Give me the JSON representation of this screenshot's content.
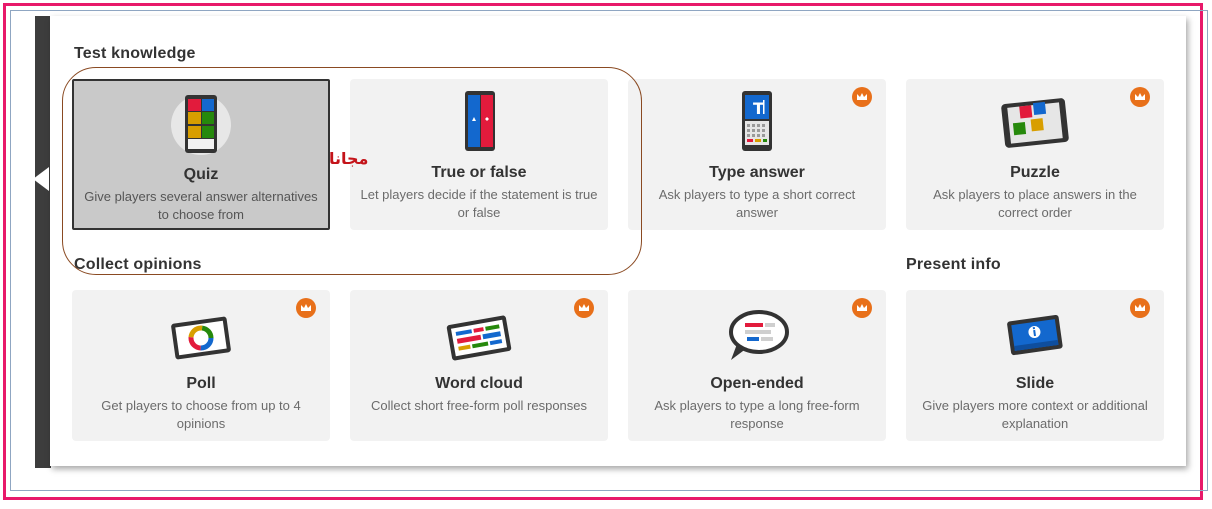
{
  "sections": {
    "test_knowledge": "Test knowledge",
    "collect_opinions": "Collect opinions",
    "present_info": "Present info"
  },
  "annotation": {
    "free_label": "مجانا"
  },
  "colors": {
    "frame_border": "#e8196a",
    "selected_card": "#c9c9c9",
    "card_bg": "#f2f2f2",
    "crown": "#e8701a",
    "annotation_text": "#c4141a",
    "annotation_oval": "#8a4a22"
  },
  "cards": {
    "quiz": {
      "title": "Quiz",
      "desc": "Give players several answer alternatives to choose from",
      "icon": "quiz-icon",
      "premium": false,
      "selected": true
    },
    "true_false": {
      "title": "True or false",
      "desc": "Let players decide if the statement is true or false",
      "icon": "true-false-icon",
      "premium": false
    },
    "type_answer": {
      "title": "Type answer",
      "desc": "Ask players to type a short correct answer",
      "icon": "type-answer-icon",
      "premium": true
    },
    "puzzle": {
      "title": "Puzzle",
      "desc": "Ask players to place answers in the correct order",
      "icon": "puzzle-icon",
      "premium": true
    },
    "poll": {
      "title": "Poll",
      "desc": "Get players to choose from up to 4 opinions",
      "icon": "poll-icon",
      "premium": true
    },
    "word_cloud": {
      "title": "Word cloud",
      "desc": "Collect short free-form poll responses",
      "icon": "word-cloud-icon",
      "premium": true
    },
    "open_ended": {
      "title": "Open-ended",
      "desc": "Ask players to type a long free-form response",
      "icon": "open-ended-icon",
      "premium": true
    },
    "slide": {
      "title": "Slide",
      "desc": "Give players more context or additional explanation",
      "icon": "slide-icon",
      "premium": true
    }
  }
}
